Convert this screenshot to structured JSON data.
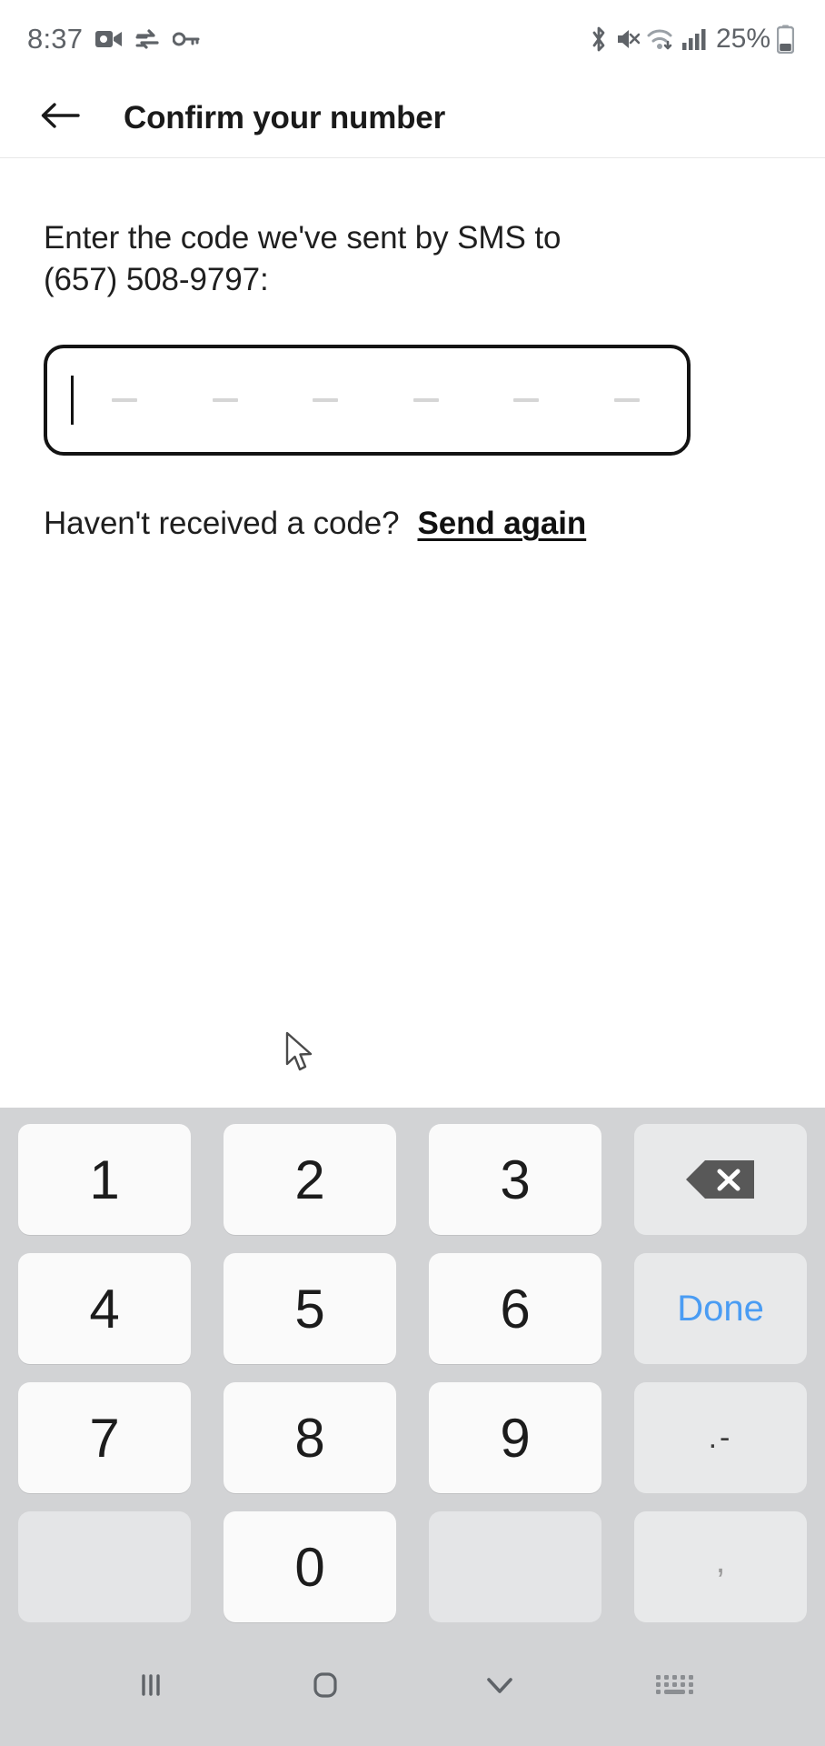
{
  "status_bar": {
    "time": "8:37",
    "battery_percent": "25%",
    "left_icons": [
      "camera-icon",
      "sync-arrows-icon",
      "key-icon"
    ],
    "right_icons": [
      "bluetooth-icon",
      "mute-icon",
      "wifi-icon",
      "cellular-signal-icon",
      "battery-icon"
    ]
  },
  "app_bar": {
    "back_icon": "arrow-left-icon",
    "title": "Confirm your number"
  },
  "content": {
    "instruction": "Enter the code we've sent by SMS to (657) 508-9797:",
    "code_field": {
      "value": "",
      "slot_count": 6,
      "caret_visible": true
    },
    "resend": {
      "question": "Haven't received a code?",
      "link_label": "Send again"
    }
  },
  "keyboard": {
    "rows": [
      [
        {
          "label": "1",
          "name": "key-1",
          "type": "digit"
        },
        {
          "label": "2",
          "name": "key-2",
          "type": "digit"
        },
        {
          "label": "3",
          "name": "key-3",
          "type": "digit"
        },
        {
          "label": "",
          "name": "key-backspace",
          "type": "backspace"
        }
      ],
      [
        {
          "label": "4",
          "name": "key-4",
          "type": "digit"
        },
        {
          "label": "5",
          "name": "key-5",
          "type": "digit"
        },
        {
          "label": "6",
          "name": "key-6",
          "type": "digit"
        },
        {
          "label": "Done",
          "name": "key-done",
          "type": "done"
        }
      ],
      [
        {
          "label": "7",
          "name": "key-7",
          "type": "digit"
        },
        {
          "label": "8",
          "name": "key-8",
          "type": "digit"
        },
        {
          "label": "9",
          "name": "key-9",
          "type": "digit"
        },
        {
          "label": ".-",
          "name": "key-punctuation",
          "type": "punct"
        }
      ],
      [
        {
          "label": "",
          "name": "key-blank-left",
          "type": "blank"
        },
        {
          "label": "0",
          "name": "key-0",
          "type": "digit"
        },
        {
          "label": "",
          "name": "key-blank-right",
          "type": "blank"
        },
        {
          "label": ",",
          "name": "key-comma",
          "type": "comma"
        }
      ]
    ]
  },
  "nav_bar": {
    "items": [
      {
        "name": "nav-recents-button",
        "icon": "recents-icon"
      },
      {
        "name": "nav-home-button",
        "icon": "home-icon"
      },
      {
        "name": "nav-hide-keyboard-button",
        "icon": "chevron-down-icon"
      },
      {
        "name": "nav-keyboard-switch-button",
        "icon": "keyboard-icon"
      }
    ]
  },
  "colors": {
    "accent_blue": "#4a9cf3",
    "keyboard_bg": "#d2d3d5",
    "key_bg": "#fafafa",
    "fn_key_bg": "#e8e9ea",
    "text": "#1f1f1f"
  }
}
